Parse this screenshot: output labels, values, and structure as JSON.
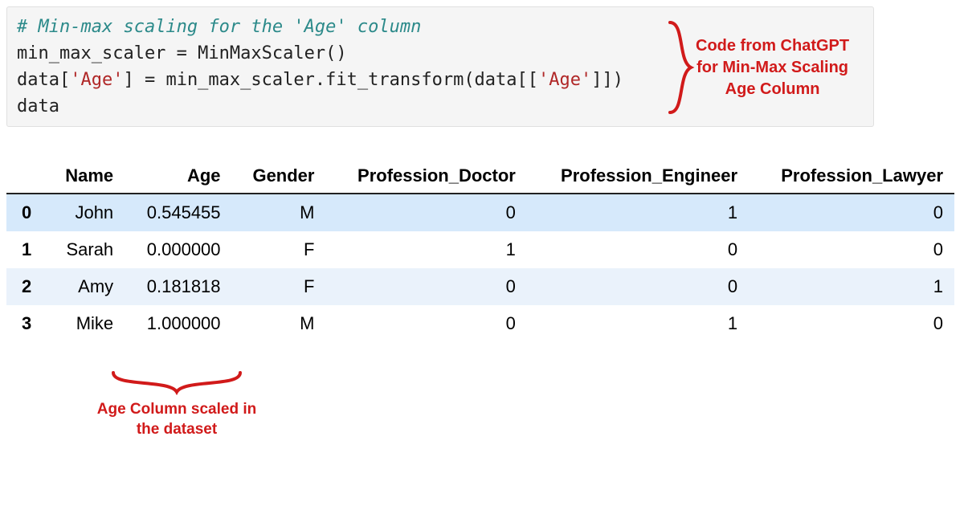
{
  "code": {
    "lines": [
      {
        "type": "comment",
        "text": "# Min-max scaling for the 'Age' column"
      },
      {
        "type": "plain",
        "text": "min_max_scaler = MinMaxScaler()"
      },
      {
        "type": "mixed",
        "pre": "data[",
        "str1": "'Age'",
        "mid": "] = min_max_scaler.fit_transform(data[[",
        "str2": "'Age'",
        "post": "]])"
      },
      {
        "type": "plain",
        "text": "data"
      }
    ]
  },
  "annotations": {
    "right_line1": "Code from ChatGPT",
    "right_line2": "for Min-Max Scaling",
    "right_line3": "Age Column",
    "bottom_line1": "Age Column scaled in",
    "bottom_line2": "the dataset"
  },
  "table": {
    "headers": [
      "",
      "Name",
      "Age",
      "Gender",
      "Profession_Doctor",
      "Profession_Engineer",
      "Profession_Lawyer"
    ],
    "rows": [
      {
        "idx": "0",
        "name": "John",
        "age": "0.545455",
        "gender": "M",
        "doc": "0",
        "eng": "1",
        "law": "0",
        "highlight": true
      },
      {
        "idx": "1",
        "name": "Sarah",
        "age": "0.000000",
        "gender": "F",
        "doc": "1",
        "eng": "0",
        "law": "0",
        "highlight": false
      },
      {
        "idx": "2",
        "name": "Amy",
        "age": "0.181818",
        "gender": "F",
        "doc": "0",
        "eng": "0",
        "law": "1",
        "highlight": false
      },
      {
        "idx": "3",
        "name": "Mike",
        "age": "1.000000",
        "gender": "M",
        "doc": "0",
        "eng": "1",
        "law": "0",
        "highlight": false
      }
    ]
  },
  "chart_data": {
    "type": "table",
    "title": "DataFrame output after Min-Max scaling of Age column",
    "columns": [
      "Name",
      "Age",
      "Gender",
      "Profession_Doctor",
      "Profession_Engineer",
      "Profession_Lawyer"
    ],
    "index": [
      0,
      1,
      2,
      3
    ],
    "data": [
      [
        "John",
        0.545455,
        "M",
        0,
        1,
        0
      ],
      [
        "Sarah",
        0.0,
        "F",
        1,
        0,
        0
      ],
      [
        "Amy",
        0.181818,
        "F",
        0,
        0,
        1
      ],
      [
        "Mike",
        1.0,
        "M",
        0,
        1,
        0
      ]
    ]
  }
}
